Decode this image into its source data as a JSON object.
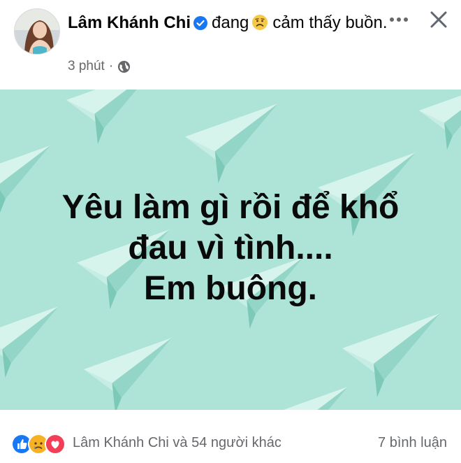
{
  "post": {
    "author": "Lâm Khánh Chi",
    "feeling_prefix": "đang",
    "feeling_text": "cảm thấy buồn.",
    "time": "3 phút",
    "separator": "·",
    "privacy_icon": "globe-icon"
  },
  "card": {
    "background": "#aee3d7",
    "lines": [
      "Yêu làm gì rồi để khổ",
      "đau vì tình....",
      "Em buông."
    ]
  },
  "footer": {
    "reactions": [
      "like",
      "sad",
      "love"
    ],
    "reactors": "Lâm Khánh Chi và 54 người khác",
    "comments": "7 bình luận"
  },
  "colors": {
    "verified": "#1877f2",
    "like": "#1877f2",
    "love": "#f33e58",
    "sad": "#f7b125",
    "muted": "#65676b"
  }
}
